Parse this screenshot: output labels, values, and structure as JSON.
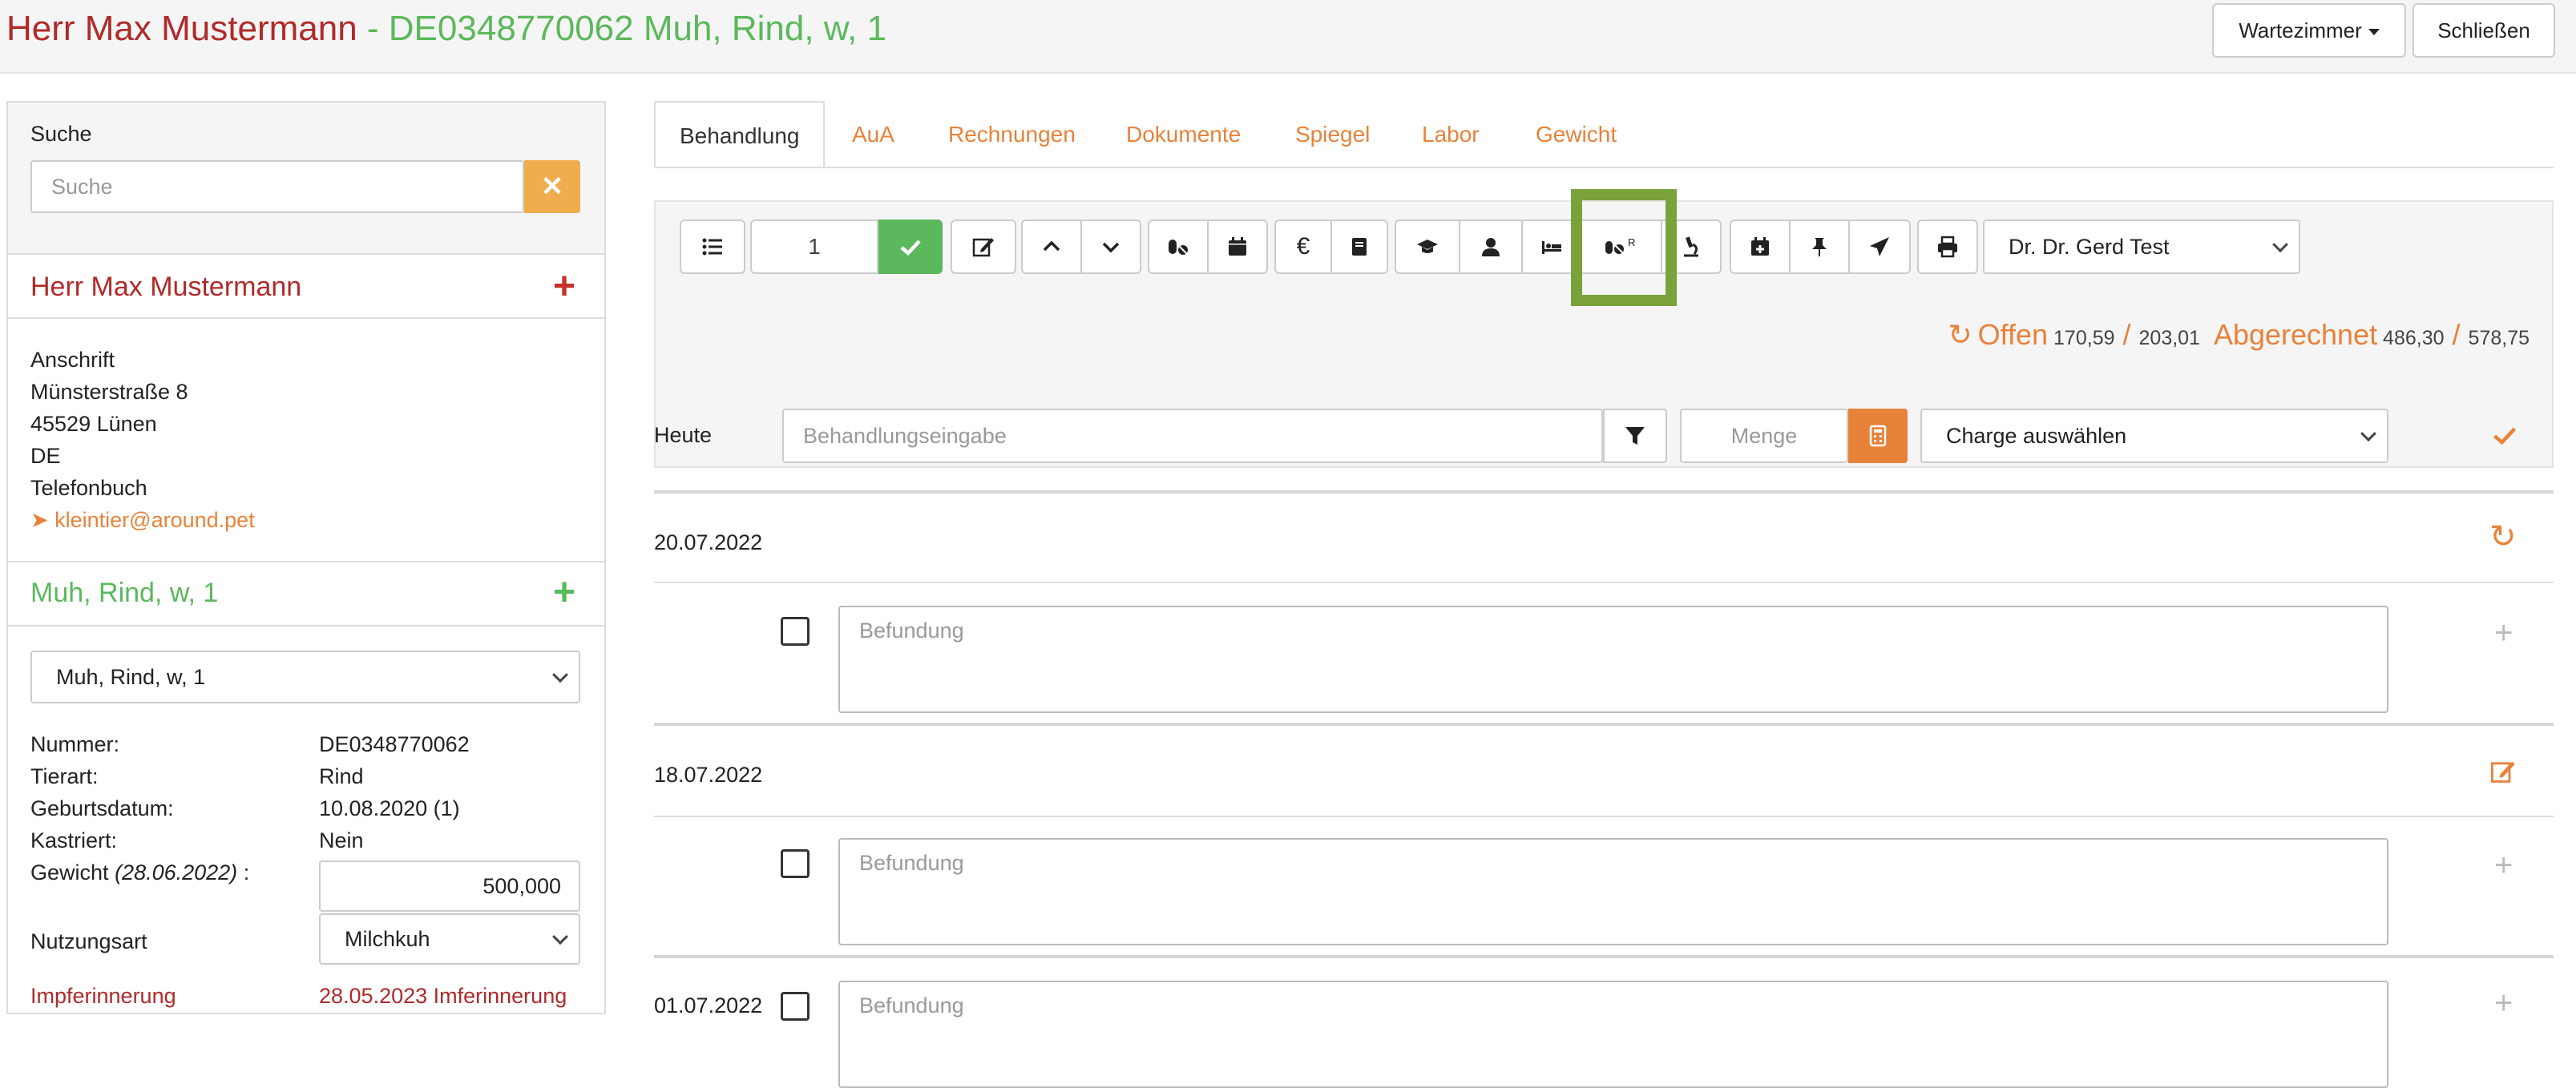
{
  "header": {
    "owner": "Herr Max Mustermann",
    "separator": " - ",
    "animal": "DE0348770062 Muh, Rind, w, 1",
    "wartezimmer_label": "Wartezimmer",
    "close_label": "Schließen"
  },
  "sidebar": {
    "search_label": "Suche",
    "search_placeholder": "Suche",
    "owner_name": "Herr Max Mustermann",
    "address": {
      "heading": "Anschrift",
      "street": "Münsterstraße 8",
      "city": "45529  Lünen",
      "country": "DE",
      "phonebook": "Telefonbuch",
      "email": "kleintier@around.pet"
    },
    "animal_name": "Muh, Rind, w, 1",
    "animal_select": "Muh, Rind, w, 1",
    "details": {
      "nummer_label": "Nummer:",
      "nummer": "DE0348770062",
      "tierart_label": "Tierart:",
      "tierart": "Rind",
      "geburtsdatum_label": "Geburtsdatum:",
      "geburtsdatum": "10.08.2020  (1)",
      "kastriert_label": "Kastriert:",
      "kastriert": "Nein",
      "gewicht_label": "Gewicht",
      "gewicht_date": "(28.06.2022)",
      "gewicht_colon": " :",
      "gewicht": "500,000",
      "nutzungsart_label": "Nutzungsart",
      "nutzungsart": "Milchkuh",
      "impf_label": "Impferinnerung",
      "impf_value": "28.05.2023 Imferinnerung"
    }
  },
  "tabs": [
    "Behandlung",
    "AuA",
    "Rechnungen",
    "Dokumente",
    "Spiegel",
    "Labor",
    "Gewicht"
  ],
  "toolbar": {
    "count": "1",
    "doctor": "Dr. Dr. Gerd Test",
    "offen_label": "Offen",
    "offen_1": "170,59",
    "offen_2": "203,01",
    "abgerechnet_label": "Abgerechnet",
    "abgerechnet_1": "486,30",
    "abgerechnet_2": "578,75",
    "slash": "/"
  },
  "entry": {
    "today_label": "Heute",
    "behandlung_placeholder": "Behandlungseingabe",
    "menge_placeholder": "Menge",
    "charge_select": "Charge auswählen"
  },
  "records": [
    {
      "date": "20.07.2022",
      "befund_placeholder": "Befundung"
    },
    {
      "date": "18.07.2022",
      "befund_placeholder": "Befundung"
    },
    {
      "date": "01.07.2022",
      "befund_placeholder": "Befundung"
    }
  ],
  "colors": {
    "owner_red": "#b02a2a",
    "animal_green": "#5cb85c",
    "accent_orange": "#e8823a",
    "highlight_green": "#7aa23a"
  }
}
